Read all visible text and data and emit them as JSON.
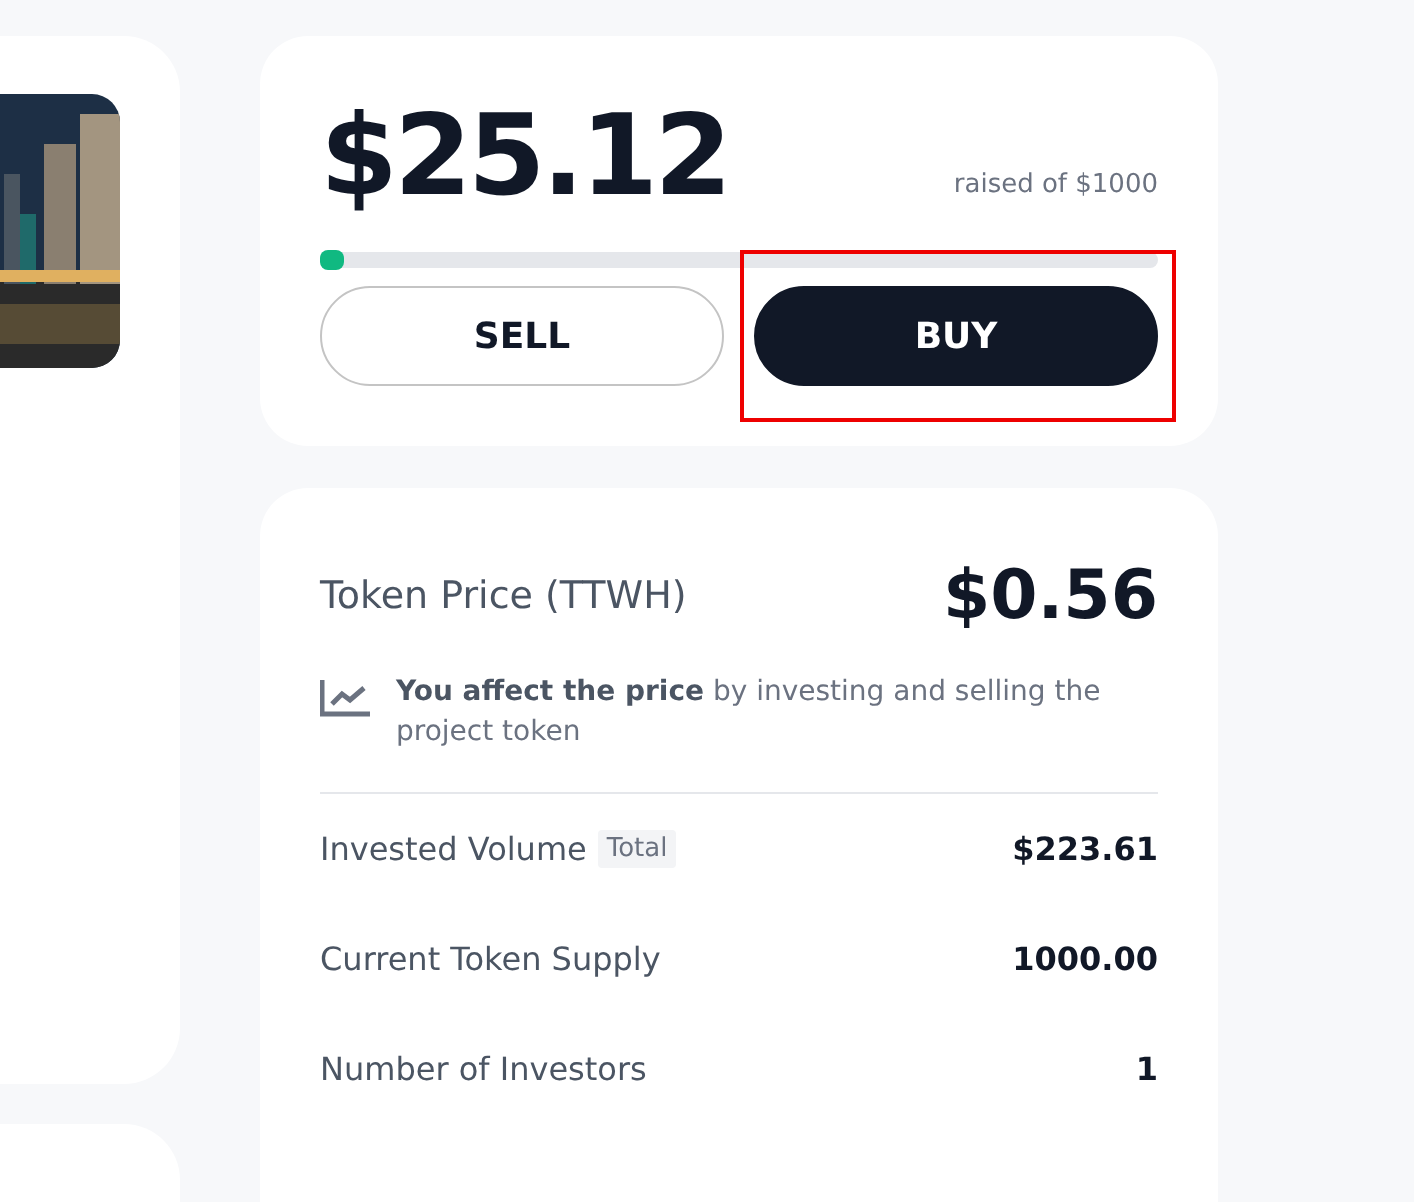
{
  "funding": {
    "raised": "$25.12",
    "goal_label": "raised of $1000",
    "level": 0.025,
    "buttons": [
      {
        "label": "SELL",
        "kind": "outline"
      },
      {
        "label": "BUY",
        "kind": "primary",
        "highlighted": true
      }
    ]
  },
  "token": {
    "title": "Token Price (TTWH)",
    "price": "$0.56",
    "note": "**You affect the price** by investing and selling the project token",
    "stats": [
      {
        "label": "Invested Volume",
        "badge": "Total",
        "value": "$223.61"
      },
      {
        "label": "Current Token Supply",
        "value": "1000.00"
      },
      {
        "label": "Number of Investors",
        "value": "1"
      }
    ]
  }
}
